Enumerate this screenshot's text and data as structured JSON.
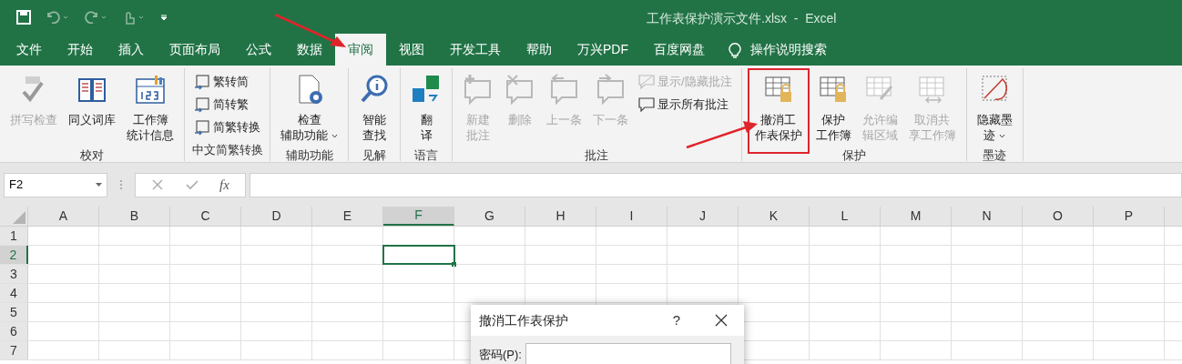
{
  "title": "工作表保护演示文件.xlsx  -  Excel",
  "tabs": [
    {
      "label": "文件",
      "selected": false
    },
    {
      "label": "开始",
      "selected": false
    },
    {
      "label": "插入",
      "selected": false
    },
    {
      "label": "页面布局",
      "selected": false
    },
    {
      "label": "公式",
      "selected": false
    },
    {
      "label": "数据",
      "selected": false
    },
    {
      "label": "审阅",
      "selected": true
    },
    {
      "label": "视图",
      "selected": false
    },
    {
      "label": "开发工具",
      "selected": false
    },
    {
      "label": "帮助",
      "selected": false
    },
    {
      "label": "万兴PDF",
      "selected": false
    },
    {
      "label": "百度网盘",
      "selected": false
    }
  ],
  "tell_me": "操作说明搜索",
  "ribbon_groups": [
    {
      "label": "校对",
      "items": [
        {
          "kind": "large",
          "lines": [
            "拼写检查"
          ],
          "disabled": true,
          "dropdown": false,
          "annotated": false
        },
        {
          "kind": "large",
          "lines": [
            "同义词库"
          ],
          "disabled": false,
          "dropdown": false,
          "annotated": false
        },
        {
          "kind": "large",
          "lines": [
            "工作簿",
            "统计信息"
          ],
          "disabled": false,
          "dropdown": false,
          "annotated": false
        }
      ]
    },
    {
      "label": "中文简繁转换",
      "items": [
        {
          "kind": "small",
          "lines": [
            "繁转简"
          ],
          "disabled": false,
          "dropdown": false,
          "annotated": false
        },
        {
          "kind": "small",
          "lines": [
            "简转繁"
          ],
          "disabled": false,
          "dropdown": false,
          "annotated": false
        },
        {
          "kind": "small",
          "lines": [
            "简繁转换"
          ],
          "disabled": false,
          "dropdown": false,
          "annotated": false
        }
      ]
    },
    {
      "label": "辅助功能",
      "items": [
        {
          "kind": "large",
          "lines": [
            "检查",
            "辅助功能"
          ],
          "disabled": false,
          "dropdown": true,
          "annotated": false
        }
      ]
    },
    {
      "label": "见解",
      "items": [
        {
          "kind": "large",
          "lines": [
            "智能",
            "查找"
          ],
          "disabled": false,
          "dropdown": false,
          "annotated": false
        }
      ]
    },
    {
      "label": "语言",
      "items": [
        {
          "kind": "large",
          "lines": [
            "翻",
            "译"
          ],
          "disabled": false,
          "dropdown": false,
          "annotated": false
        }
      ]
    },
    {
      "label": "批注",
      "items": [
        {
          "kind": "large",
          "lines": [
            "新建",
            "批注"
          ],
          "disabled": true,
          "dropdown": false,
          "annotated": false
        },
        {
          "kind": "large",
          "lines": [
            "删除"
          ],
          "disabled": true,
          "dropdown": false,
          "annotated": false
        },
        {
          "kind": "large",
          "lines": [
            "上一条"
          ],
          "disabled": true,
          "dropdown": false,
          "annotated": false
        },
        {
          "kind": "large",
          "lines": [
            "下一条"
          ],
          "disabled": true,
          "dropdown": false,
          "annotated": false
        },
        {
          "kind": "small",
          "lines": [
            "显示/隐藏批注"
          ],
          "disabled": true,
          "dropdown": false,
          "annotated": false
        },
        {
          "kind": "small",
          "lines": [
            "显示所有批注"
          ],
          "disabled": false,
          "dropdown": false,
          "annotated": false
        }
      ]
    },
    {
      "label": "保护",
      "items": [
        {
          "kind": "large",
          "lines": [
            "撤消工",
            "作表保护"
          ],
          "disabled": false,
          "dropdown": false,
          "annotated": true
        },
        {
          "kind": "large",
          "lines": [
            "保护",
            "工作簿"
          ],
          "disabled": false,
          "dropdown": false,
          "annotated": false
        },
        {
          "kind": "large",
          "lines": [
            "允许编",
            "辑区域"
          ],
          "disabled": true,
          "dropdown": false,
          "annotated": false
        },
        {
          "kind": "large",
          "lines": [
            "取消共",
            "享工作簿"
          ],
          "disabled": true,
          "dropdown": false,
          "annotated": false
        }
      ]
    },
    {
      "label": "墨迹",
      "items": [
        {
          "kind": "large",
          "lines": [
            "隐藏墨",
            "迹"
          ],
          "disabled": false,
          "dropdown": true,
          "annotated": false
        }
      ]
    }
  ],
  "name_box": "F2",
  "fx": "fx",
  "columns": [
    {
      "label": "A",
      "selected": false
    },
    {
      "label": "B",
      "selected": false
    },
    {
      "label": "C",
      "selected": false
    },
    {
      "label": "D",
      "selected": false
    },
    {
      "label": "E",
      "selected": false
    },
    {
      "label": "F",
      "selected": true
    },
    {
      "label": "G",
      "selected": false
    },
    {
      "label": "H",
      "selected": false
    },
    {
      "label": "I",
      "selected": false
    },
    {
      "label": "J",
      "selected": false
    },
    {
      "label": "K",
      "selected": false
    },
    {
      "label": "L",
      "selected": false
    },
    {
      "label": "M",
      "selected": false
    },
    {
      "label": "N",
      "selected": false
    },
    {
      "label": "O",
      "selected": false
    },
    {
      "label": "P",
      "selected": false
    }
  ],
  "rows": [
    {
      "label": "1",
      "selected": false
    },
    {
      "label": "2",
      "selected": true
    },
    {
      "label": "3",
      "selected": false
    },
    {
      "label": "4",
      "selected": false
    },
    {
      "label": "5",
      "selected": false
    },
    {
      "label": "6",
      "selected": false
    },
    {
      "label": "7",
      "selected": false
    }
  ],
  "dialog": {
    "title": "撤消工作表保护",
    "help": "?",
    "password_label": "密码(P):"
  }
}
